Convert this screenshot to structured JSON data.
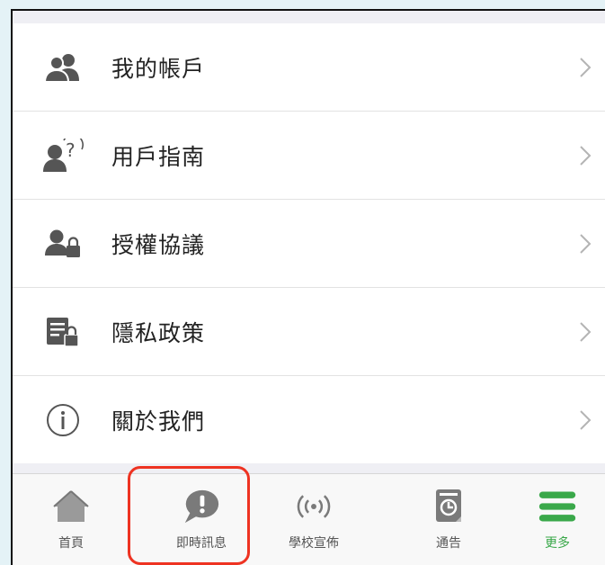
{
  "menu": {
    "items": [
      {
        "label": "我的帳戶",
        "icon": "users-icon"
      },
      {
        "label": "用戶指南",
        "icon": "user-question-icon"
      },
      {
        "label": "授權協議",
        "icon": "user-lock-icon"
      },
      {
        "label": "隱私政策",
        "icon": "document-lock-icon"
      },
      {
        "label": "關於我們",
        "icon": "info-icon"
      }
    ]
  },
  "tabbar": {
    "tabs": [
      {
        "label": "首頁",
        "icon": "home-icon"
      },
      {
        "label": "即時訊息",
        "icon": "chat-alert-icon"
      },
      {
        "label": "學校宣佈",
        "icon": "broadcast-icon"
      },
      {
        "label": "通告",
        "icon": "notice-icon"
      },
      {
        "label": "更多",
        "icon": "menu-icon"
      }
    ],
    "active_index": 4,
    "highlighted_index": 1
  },
  "colors": {
    "accent": "#3aa84a",
    "highlight": "#ee3322",
    "icon": "#555555"
  }
}
